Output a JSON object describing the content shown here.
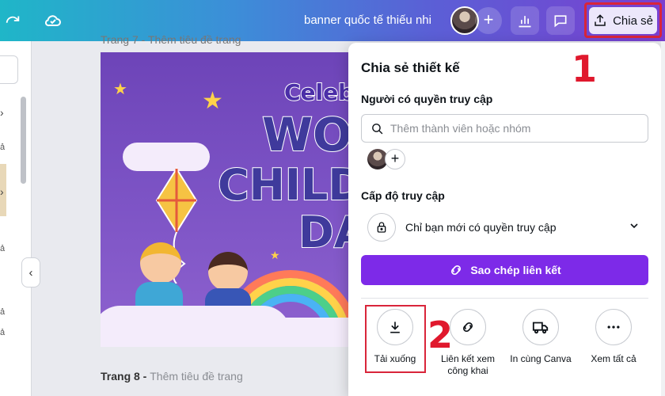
{
  "topbar": {
    "doc_title": "banner quốc tế thiếu nhi",
    "share_label": "Chia sẻ",
    "icons": [
      "redo-icon",
      "cloud-check-icon",
      "add-collaborator-icon",
      "insights-chart-icon",
      "comment-icon",
      "share-upload-icon"
    ]
  },
  "canvas": {
    "page_top_label": "Trang 7 - Thêm tiêu đề trang",
    "page_bottom_label_prefix": "Trang 8 - ",
    "page_bottom_label_muted": "Thêm tiêu đề trang",
    "design_text": {
      "line1": "Celeb",
      "line2": "WO",
      "line3": "CHILD",
      "line4": "DA"
    }
  },
  "left_strip": {
    "side_chars": [
      "ả",
      "ả",
      "ả",
      "ả"
    ]
  },
  "share_panel": {
    "title": "Chia sẻ thiết kế",
    "people_label": "Người có quyền truy cập",
    "search_placeholder": "Thêm thành viên hoặc nhóm",
    "access_level_label": "Cấp độ truy cập",
    "access_value": "Chỉ bạn mới có quyền truy cập",
    "copy_link_label": "Sao chép liên kết",
    "options": [
      {
        "label": "Tải xuống",
        "icon": "download-icon"
      },
      {
        "label": "Liên kết xem công khai",
        "icon": "link-icon"
      },
      {
        "label": "In cùng Canva",
        "icon": "truck-icon"
      },
      {
        "label": "Xem tất cả",
        "icon": "more-dots-icon"
      }
    ]
  },
  "annotations": {
    "step1": "1",
    "step2": "2",
    "color": "#e0182d"
  },
  "colors": {
    "accent_purple": "#7d2ae8",
    "highlight_red": "#d9253a"
  }
}
